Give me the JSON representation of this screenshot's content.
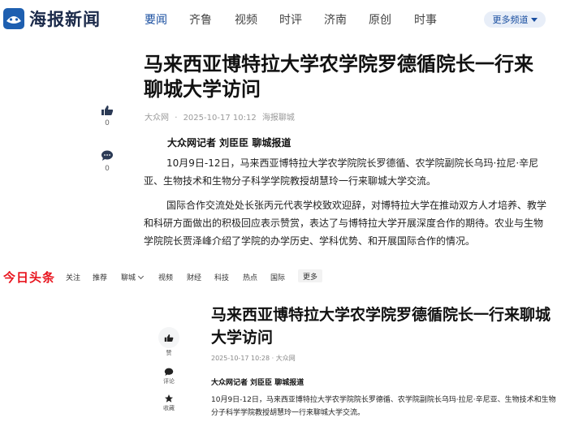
{
  "haibao": {
    "logo_text": "海报新闻",
    "nav": [
      "要闻",
      "齐鲁",
      "视频",
      "时评",
      "济南",
      "原创",
      "时事"
    ],
    "nav_active_index": 0,
    "more_channels": "更多频道",
    "article": {
      "title": "马来西亚博特拉大学农学院罗德循院长一行来聊城大学访问",
      "source": "大众网",
      "separator": "·",
      "datetime": "2025-10-17 10:12",
      "channel": "海报聊城",
      "like_count": "0",
      "comment_count": "0",
      "byline": "大众网记者 刘臣臣 聊城报道",
      "paragraphs": [
        "10月9日-12日，马来西亚博特拉大学农学院院长罗德循、农学院副院长乌玛·拉尼·辛尼亚、生物技术和生物分子科学学院教授胡慧玲一行来聊城大学交流。",
        "国际合作交流处处长张丙元代表学校致欢迎辞，对博特拉大学在推动双方人才培养、教学和科研方面做出的积极回应表示赞赏，表达了与博特拉大学开展深度合作的期待。农业与生物学院院长贾泽峰介绍了学院的办学历史、学科优势、和开展国际合作的情况。"
      ]
    }
  },
  "toutiao": {
    "logo_text": "今日头条",
    "nav": [
      "关注",
      "推荐",
      "聊城",
      "视频",
      "财经",
      "科技",
      "热点",
      "国际"
    ],
    "more": "更多",
    "article": {
      "title": "马来西亚博特拉大学农学院罗德循院长一行来聊城大学访问",
      "meta": "2025-10-17 10:28 · 大众网",
      "byline": "大众网记者 刘臣臣 聊城报道",
      "paragraph": "10月9日-12日，马来西亚博特拉大学农学院院长罗德循、农学院副院长乌玛·拉尼·辛尼亚、生物技术和生物分子科学学院教授胡慧玲一行来聊城大学交流。",
      "actions": [
        "赞",
        "评论",
        "收藏"
      ]
    }
  },
  "colors": {
    "haibao_brand": "#1e5fb0",
    "haibao_nav_active": "#1a4fa0",
    "toutiao_brand": "#e8131d"
  },
  "icons": [
    "haibao-logo-icon",
    "thumbs-up-icon",
    "comment-icon",
    "star-icon",
    "caret-down-icon",
    "chevron-down-icon"
  ]
}
